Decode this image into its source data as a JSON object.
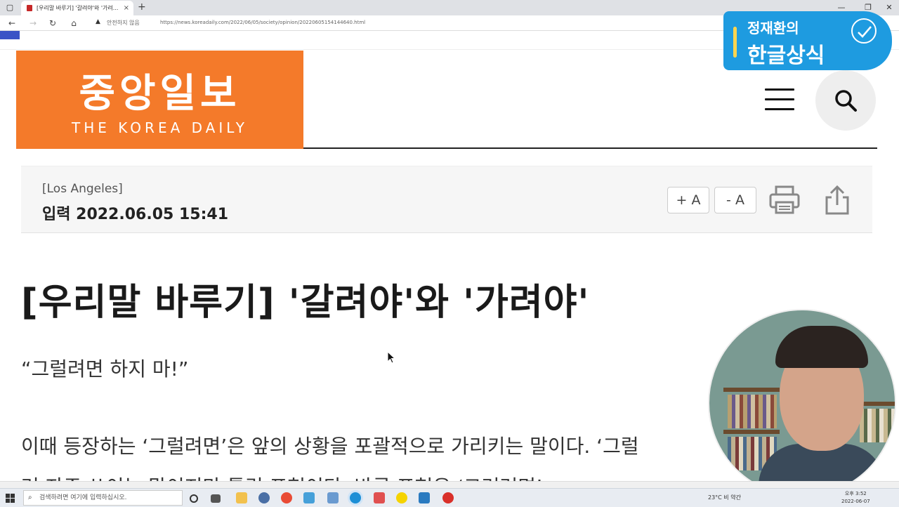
{
  "browser": {
    "tab_title": "[우리말 바루기] '갈려야'와 '가려...",
    "tab_close": "×",
    "new_tab": "+",
    "back": "←",
    "forward": "→",
    "reload": "↻",
    "home": "⌂",
    "security_icon": "▲",
    "security_label": "안전하지 않음",
    "url": "https://news.koreadaily.com/2022/06/05/society/opinion/20220605154144640.html",
    "window_controls": {
      "minimize": "—",
      "restore": "❐",
      "close": "✕"
    }
  },
  "channel_badge": {
    "name": "정재환의",
    "title": "한글상식"
  },
  "site": {
    "logo_korean": "중앙일보",
    "logo_english": "THE KOREA DAILY"
  },
  "meta": {
    "location": "[Los Angeles]",
    "date": "입력 2022.06.05 15:41",
    "font_increase": "+ A",
    "font_decrease": "- A"
  },
  "article": {
    "headline": "[우리말 바루기] '갈려야'와 '가려야'",
    "paragraphs": [
      "“그럴려면 하지 마!”",
      "이때 등장하는 ‘그럴려면’은 앞의 상황을 포괄적으로 가리키는 말이다. ‘그럴",
      "러 자주 쓰이는 말이지만 틀린 표현이다. 바른 표현은 ‘그러려면’"
    ]
  },
  "taskbar": {
    "search_placeholder": "검색하려면 여기에 입력하십시오.",
    "weather": "23°C 비 약간",
    "time": "오후 3:52",
    "date": "2022-06-07"
  }
}
